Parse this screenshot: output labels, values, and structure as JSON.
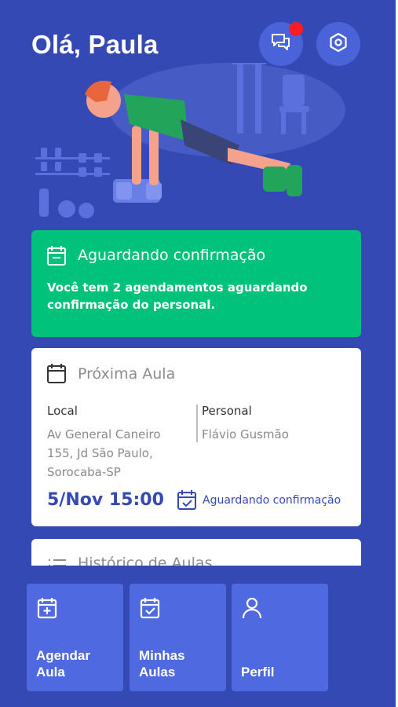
{
  "header": {
    "greeting": "Olá, Paula"
  },
  "icons": {
    "chat": "chat-bubbles-icon",
    "settings": "hexagon-settings-icon",
    "calendar": "calendar-icon",
    "calendar_check": "calendar-check-icon",
    "calendar_plus": "calendar-plus-icon",
    "list": "list-icon",
    "user": "user-icon"
  },
  "pending": {
    "title": "Aguardando confirmação",
    "message": "Você tem 2 agendamentos aguardando confirmação do personal."
  },
  "next_class": {
    "title": "Próxima Aula",
    "local_label": "Local",
    "local_value": "Av General Caneiro 155, Jd São Paulo, Sorocaba-SP",
    "personal_label": "Personal",
    "personal_value": "Flávio Gusmão",
    "datetime": "5/Nov 15:00",
    "status": "Aguardando confirmação"
  },
  "history": {
    "title": "Histórico de Aulas"
  },
  "actions": [
    {
      "label": "Agendar\nAula"
    },
    {
      "label": "Minhas\nAulas"
    },
    {
      "label": "Perfil"
    }
  ],
  "colors": {
    "background": "#3549b4",
    "accent_green": "#00c27a",
    "tile": "#4f6ae0",
    "notification": "#ff1d25"
  }
}
